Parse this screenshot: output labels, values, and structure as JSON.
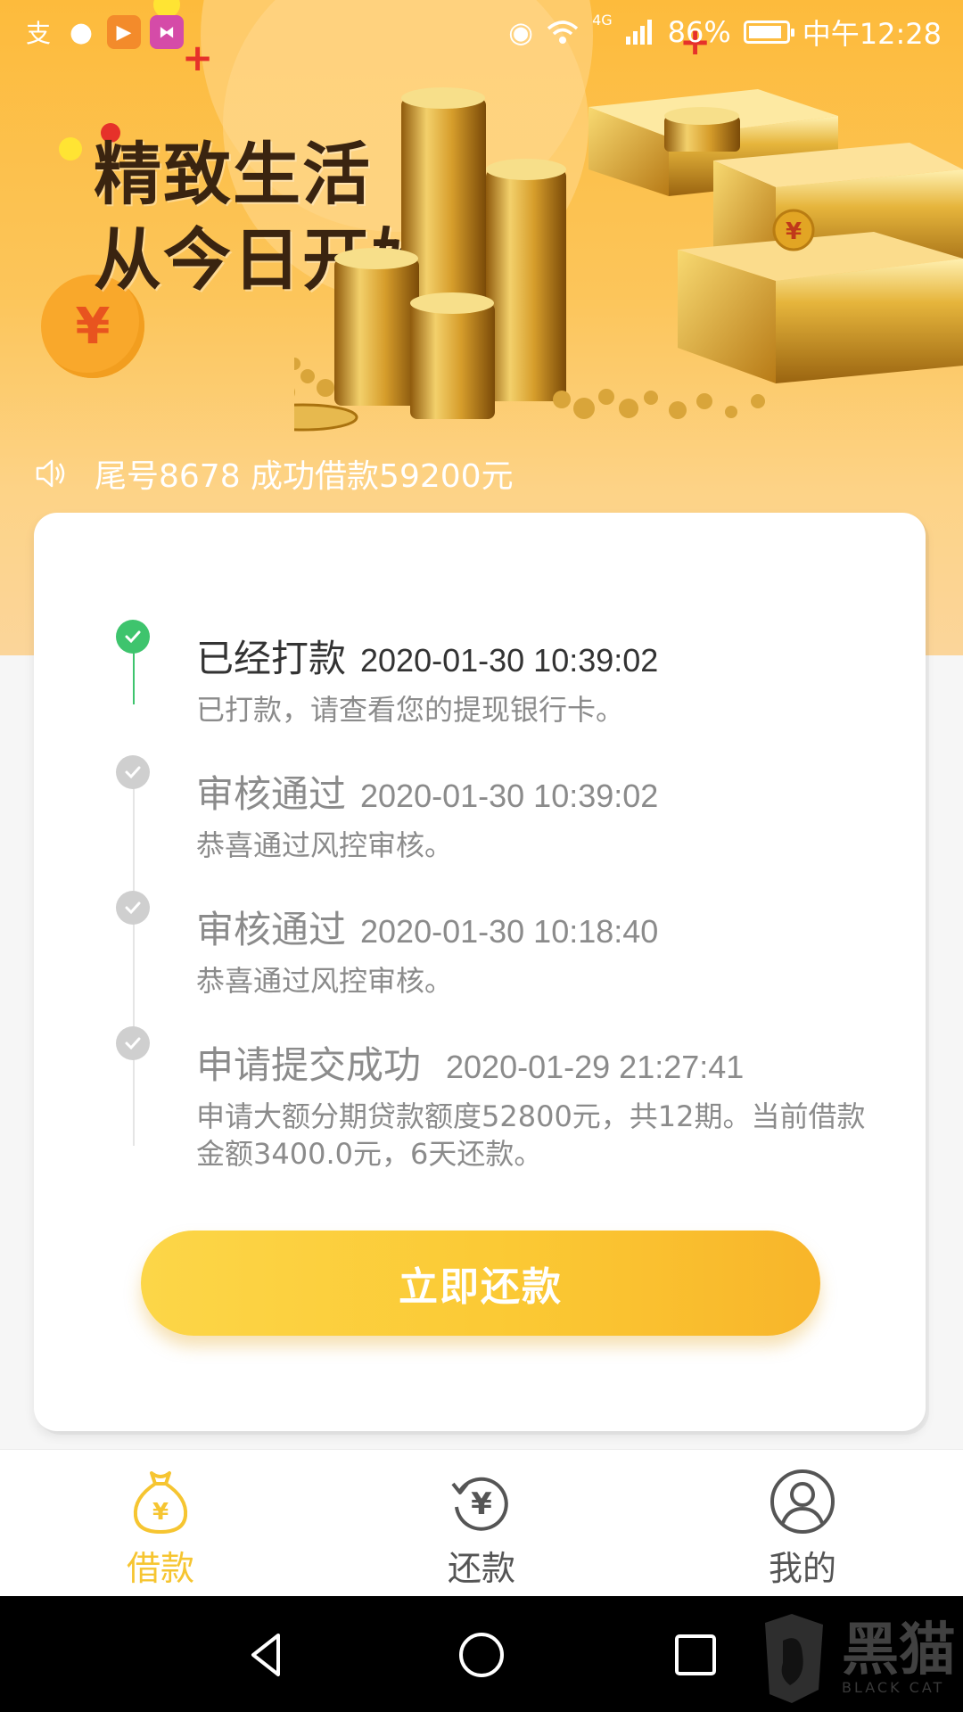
{
  "status_bar": {
    "time": "中午12:28",
    "battery": "86%",
    "network": "4G"
  },
  "banner": {
    "slogan_line1": "精致生活",
    "slogan_line2": "从今日开始",
    "coin_symbol": "¥"
  },
  "ticker": {
    "text": "尾号8678 成功借款59200元",
    "icon": "speaker-icon"
  },
  "timeline": [
    {
      "title": "已经打款",
      "time": "2020-01-30 10:39:02",
      "desc": "已打款，请查看您的提现银行卡。",
      "active": true
    },
    {
      "title": "审核通过",
      "time": "2020-01-30 10:39:02",
      "desc": "恭喜通过风控审核。",
      "active": false
    },
    {
      "title": "审核通过",
      "time": "2020-01-30 10:18:40",
      "desc": "恭喜通过风控审核。",
      "active": false
    },
    {
      "title": "申请提交成功",
      "time": "2020-01-29 21:27:41",
      "desc": "申请大额分期贷款额度52800元，共12期。当前借款金额3400.0元，6天还款。",
      "active": false
    }
  ],
  "repay_button": {
    "label": "立即还款"
  },
  "tabs": [
    {
      "label": "借款",
      "icon": "money-bag-icon",
      "active": true
    },
    {
      "label": "还款",
      "icon": "yen-refresh-icon",
      "active": false
    },
    {
      "label": "我的",
      "icon": "user-icon",
      "active": false
    }
  ],
  "colors": {
    "accent": "#f6c531",
    "active_green": "#3ec46d",
    "inactive_mark": "#cfcfcf",
    "text_dark": "#333333",
    "text_gray": "#8b8b8b",
    "tab_inactive": "#555555"
  },
  "watermark": {
    "text": "黑猫",
    "sub": "BLACK CAT"
  }
}
